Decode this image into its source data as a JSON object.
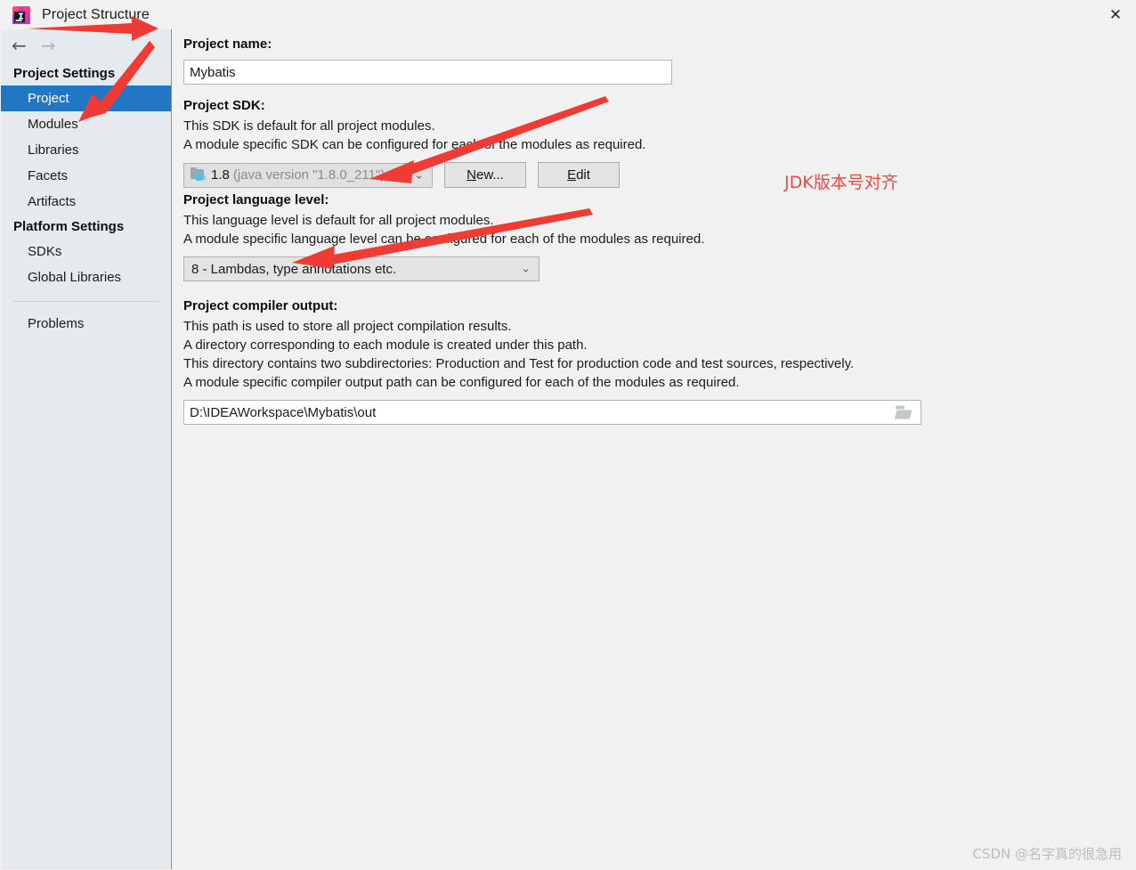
{
  "window": {
    "title": "Project Structure",
    "app_icon": "intellij-idea-icon",
    "close_label": "✕"
  },
  "sidebar": {
    "nav": {
      "back_icon": "←",
      "forward_icon": "→"
    },
    "groups": [
      {
        "heading": "Project Settings",
        "items": [
          {
            "label": "Project",
            "selected": true
          },
          {
            "label": "Modules",
            "selected": false
          },
          {
            "label": "Libraries",
            "selected": false
          },
          {
            "label": "Facets",
            "selected": false
          },
          {
            "label": "Artifacts",
            "selected": false
          }
        ]
      },
      {
        "heading": "Platform Settings",
        "items": [
          {
            "label": "SDKs",
            "selected": false
          },
          {
            "label": "Global Libraries",
            "selected": false
          }
        ]
      }
    ],
    "footer_item": {
      "label": "Problems",
      "selected": false
    }
  },
  "main": {
    "project_name": {
      "label": "Project name:",
      "value": "Mybatis",
      "placeholder": ""
    },
    "project_sdk": {
      "label": "Project SDK:",
      "desc_line1": "This SDK is default for all project modules.",
      "desc_line2": "A module specific SDK can be configured for each of the modules as required.",
      "combo_icon": "java-sdk-icon",
      "combo_version": "1.8",
      "combo_detail": "(java version \"1.8.0_211\")",
      "chevron": "⌄",
      "new_button": {
        "accel": "N",
        "rest": "ew..."
      },
      "edit_button": {
        "accel": "E",
        "rest": "dit"
      }
    },
    "language_level": {
      "label": "Project language level:",
      "desc_line1": "This language level is default for all project modules.",
      "desc_line2": "A module specific language level can be configured for each of the modules as required.",
      "value": "8 - Lambdas, type annotations etc.",
      "chevron": "⌄"
    },
    "compiler_output": {
      "label": "Project compiler output:",
      "desc_line1": "This path is used to store all project compilation results.",
      "desc_line2": "A directory corresponding to each module is created under this path.",
      "desc_line3": "This directory contains two subdirectories: Production and Test for production code and test sources, respectively.",
      "desc_line4": "A module specific compiler output path can be configured for each of the modules as required.",
      "value": "D:\\IDEAWorkspace\\Mybatis\\out",
      "browse_icon": "folder-browse-icon"
    }
  },
  "annotations": {
    "color": "#ef4a42",
    "note_text": "JDK版本号对齐",
    "arrows": [
      {
        "name": "arrow-to-title",
        "desc": "horizontal arrow pointing right toward the title bar"
      },
      {
        "name": "arrow-to-project-item",
        "desc": "diagonal arrow pointing down-left to the Project sidebar item"
      },
      {
        "name": "arrow-to-sdk-combo",
        "desc": "diagonal arrow pointing down-left to the Project SDK combo"
      },
      {
        "name": "arrow-to-language-level-combo",
        "desc": "diagonal arrow pointing down-left to the language level combo"
      }
    ]
  },
  "watermark": {
    "text": "CSDN @名字真的很急用"
  }
}
